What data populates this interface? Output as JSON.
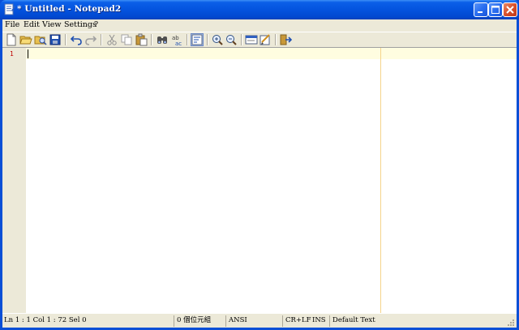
{
  "window": {
    "title": "* Untitled - Notepad2"
  },
  "menu": {
    "items": [
      "File",
      "Edit",
      "View",
      "Settings",
      "?"
    ]
  },
  "toolbar": {
    "icons": [
      "new-file-icon",
      "open-folder-icon",
      "browse-icon",
      "save-icon",
      "undo-icon",
      "redo-icon",
      "cut-icon",
      "copy-icon",
      "paste-icon",
      "find-icon",
      "replace-icon",
      "word-wrap-icon",
      "zoom-in-icon",
      "zoom-out-icon",
      "scheme-icon",
      "customize-icon",
      "exit-icon"
    ]
  },
  "editor": {
    "line_number": "1"
  },
  "status": {
    "position": "Ln 1 : 1   Col 1 : 72   Sel 0",
    "size": "0 個位元組",
    "encoding": "ANSI",
    "line_ending": "CR+LF",
    "insert_mode": "INS",
    "scheme": "Default Text"
  },
  "colors": {
    "titlebar": "#0453de",
    "line_number": "#c00000",
    "current_line": "#fffde0",
    "edge_line": "#f5d48a"
  }
}
